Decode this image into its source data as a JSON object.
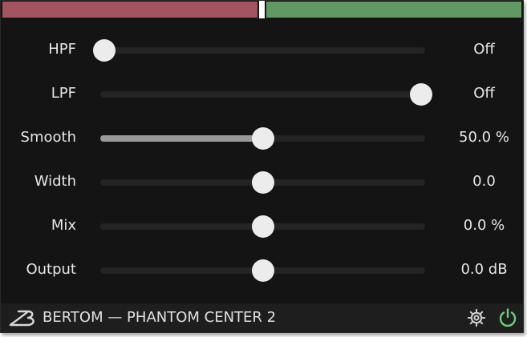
{
  "colors": {
    "meter_left": "#a4545f",
    "meter_right": "#5f9a63",
    "knob": "#ececec",
    "track": "#242424",
    "track_fill": "#9a9a9a",
    "power_icon": "#6cd07a",
    "background": "#141414"
  },
  "meters": [
    {
      "name": "left-level-meter",
      "level": 1.0
    },
    {
      "name": "right-level-meter",
      "level": 1.0
    }
  ],
  "sliders": [
    {
      "key": "hpf",
      "label": "HPF",
      "value": "Off",
      "position": 0.0,
      "fill": false
    },
    {
      "key": "lpf",
      "label": "LPF",
      "value": "Off",
      "position": 1.0,
      "fill": false
    },
    {
      "key": "smooth",
      "label": "Smooth",
      "value": "50.0 %",
      "position": 0.5,
      "fill": true
    },
    {
      "key": "width",
      "label": "Width",
      "value": "0.0",
      "position": 0.5,
      "fill": false
    },
    {
      "key": "mix",
      "label": "Mix",
      "value": "0.0 %",
      "position": 0.5,
      "fill": false
    },
    {
      "key": "output",
      "label": "Output",
      "value": "0.0 dB",
      "position": 0.5,
      "fill": false
    }
  ],
  "footer": {
    "title": "BERTOM — PHANTOM CENTER 2",
    "logo": "bertom-logo-icon",
    "settings_icon": "gear-icon",
    "power_icon": "power-icon"
  }
}
